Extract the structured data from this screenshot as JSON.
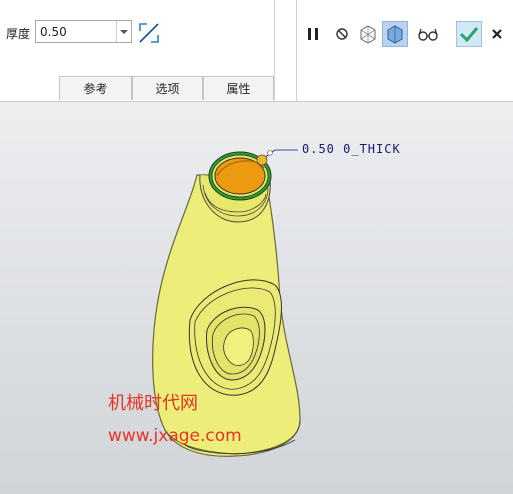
{
  "dashboard": {
    "thickness_label": "厚度",
    "thickness_value": "0.50",
    "tabs": [
      {
        "label": "参考"
      },
      {
        "label": "选项"
      },
      {
        "label": "属性"
      }
    ],
    "toolbar": {
      "icons": [
        "pause-icon",
        "stop-icon",
        "verify-icon",
        "preview-icon",
        "glasses-icon",
        "checkmark-icon",
        "close-icon"
      ],
      "accent": "#2aa56a"
    }
  },
  "model": {
    "annotation": "0.50 0_THICK",
    "body_color": "#eded7a",
    "interior_color": "#ec9a10",
    "edge_color": "#00b400"
  },
  "watermark": {
    "title": "机械时代网",
    "url": "www.jxage.com",
    "color": "#e53524"
  }
}
